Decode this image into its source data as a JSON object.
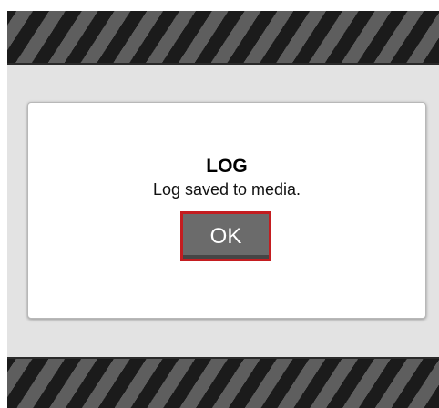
{
  "dialog": {
    "title": "LOG",
    "message": "Log saved to media.",
    "ok_label": "OK"
  },
  "colors": {
    "overlay": "#e3e3e3",
    "button_bg": "#6b6b6b",
    "button_border": "#c41d20",
    "stripe_dark": "#1b1b1b",
    "stripe_light": "#5e5e5e"
  }
}
